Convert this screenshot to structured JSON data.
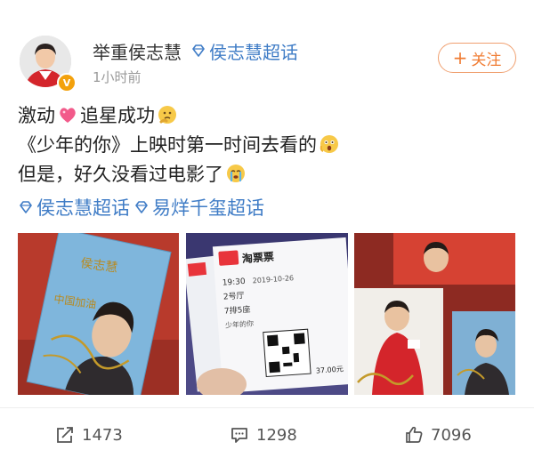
{
  "post": {
    "author": "举重侯志慧",
    "author_topic": "侯志慧超话",
    "timestamp": "1小时前",
    "follow_label": "关注",
    "lines": [
      {
        "text_a": "激动",
        "text_b": "追星成功"
      },
      {
        "text": "《少年的你》上映时第一时间去看的"
      },
      {
        "text": "但是，好久没看过电影了"
      }
    ],
    "topics": [
      "侯志慧超话",
      "易烊千玺超话"
    ],
    "images": {
      "poster_signature": "侯志慧",
      "poster_text": "中国加油",
      "ticket_brand": "淘票票",
      "ticket_time": "19:30",
      "ticket_date": "2019-10-26",
      "ticket_hall": "2号厅",
      "ticket_seat": "7排5座",
      "ticket_movie": "少年的你",
      "ticket_price": "37.00元"
    }
  },
  "actions": {
    "shares": "1473",
    "comments": "1298",
    "likes": "7096"
  },
  "icons": {
    "share": "share-icon",
    "comment": "comment-icon",
    "like": "thumbs-up-icon",
    "topic": "supertopic-diamond-icon"
  },
  "colors": {
    "link": "#3f7cc6",
    "follow": "#f07c33",
    "verified": "#f3a10c"
  }
}
